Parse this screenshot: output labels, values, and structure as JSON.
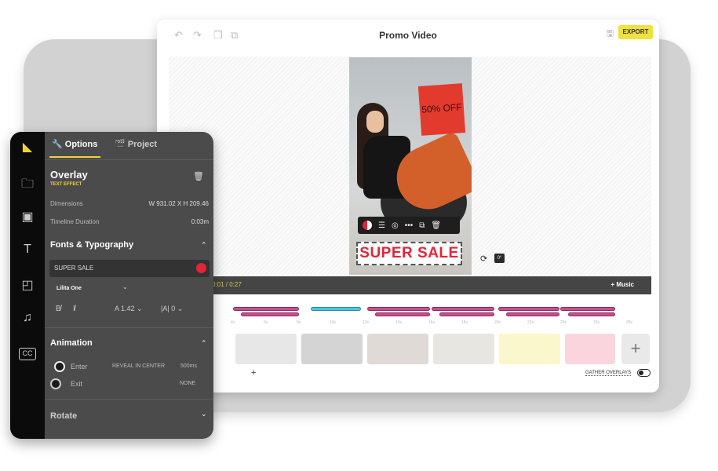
{
  "editor": {
    "title": "Promo Video",
    "export_label": "EXPORT",
    "icons": [
      "undo-icon",
      "redo-icon",
      "copy-icon",
      "duplicate-icon",
      "save-icon"
    ]
  },
  "canvas": {
    "bag_text": "50% OFF",
    "overlay_text": "SUPER SALE",
    "rotation": "0°"
  },
  "timeline": {
    "time": "0:01 / 0:27",
    "music_label": "+ Music",
    "ruler": [
      "4s",
      "6s",
      "8s",
      "10s",
      "12s",
      "14s",
      "16s",
      "18s",
      "20s",
      "22s",
      "24s",
      "26s",
      "28s"
    ],
    "gather_label": "GATHER OVERLAYS",
    "overlay_color": "#c8508c",
    "active_color": "#4ec3e0"
  },
  "panel": {
    "tabs": [
      {
        "label": "Options"
      },
      {
        "label": "Project"
      }
    ],
    "overlay_title": "Overlay",
    "overlay_subtitle": "TEXT EFFECT",
    "dimensions_label": "Dimensions",
    "dimensions_value": "W 931.02 X H 209.46",
    "duration_label": "Timeline Duration",
    "duration_value": "0:03m",
    "fonts_title": "Fonts & Typography",
    "text_value": "SUPER SALE",
    "text_color": "#e2243a",
    "font_name": "Lilita One",
    "line_height": "1.42",
    "letter_spacing": "0",
    "animation_title": "Animation",
    "enter_label": "Enter",
    "enter_effect": "REVEAL IN CENTER",
    "enter_duration": "500ms",
    "exit_label": "Exit",
    "exit_effect": "NONE",
    "rotate_title": "Rotate"
  },
  "accent": "#f0d23c"
}
